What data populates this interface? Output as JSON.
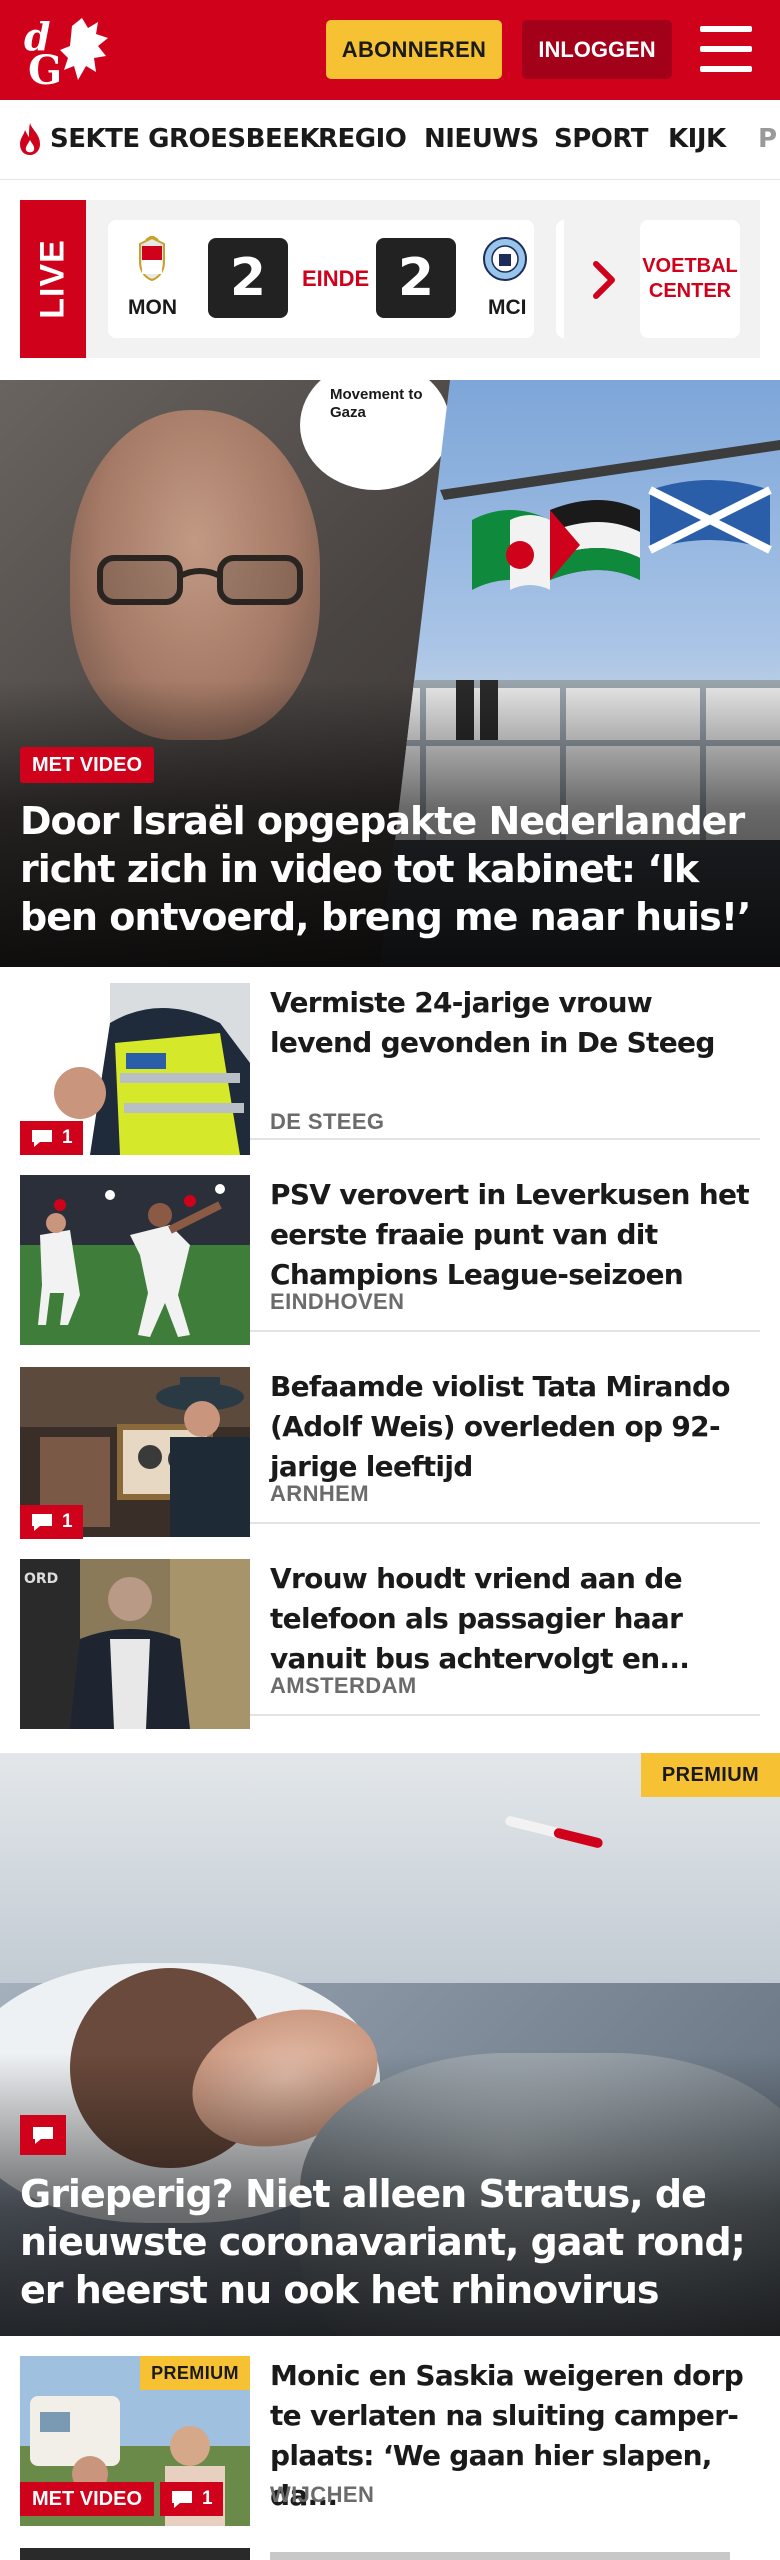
{
  "header": {
    "logo_text": "dG",
    "subscribe_label": "ABONNEREN",
    "login_label": "INLOGGEN",
    "colors": {
      "brand_red": "#d0021b",
      "subscribe_yellow": "#f6c233",
      "login_dark_red": "#a3001a"
    }
  },
  "nav": {
    "items": [
      {
        "label": "SEKTE GROESBEEK",
        "icon": "flame-icon"
      },
      {
        "label": "REGIO"
      },
      {
        "label": "NIEUWS"
      },
      {
        "label": "SPORT"
      },
      {
        "label": "KIJK"
      },
      {
        "label": "P"
      }
    ]
  },
  "live_score": {
    "live_label": "LIVE",
    "home_team": "MON",
    "home_score": "2",
    "status": "EINDE",
    "away_score": "2",
    "away_team": "MCI",
    "voetbal_center_label": "VOETBAL CENTER"
  },
  "hero": {
    "badge_text": "Movement to Gaza",
    "video_label": "MET VIDEO",
    "title": "Door Israël opgepakte Nederlander richt zich in video tot kabinet: ‘Ik ben ontvoerd, breng me naar huis!’"
  },
  "articles": [
    {
      "title": "Vermiste 24-jarige vrouw levend gevonden in De Steeg",
      "location": "DE STEEG",
      "comments": "1"
    },
    {
      "title": "PSV verovert in Leverkusen het eerste fraaie punt van dit Champions League-seizoen",
      "location": "EINDHOVEN"
    },
    {
      "title": "Befaamde violist Tata Mirando (Adolf Weis) overleden op 92-jarige leeftijd",
      "location": "ARNHEM",
      "comments": "1"
    },
    {
      "title": "Vrouw houdt vriend aan de telefoon als passagier haar vanuit bus achtervolgt en...",
      "location": "AMSTERDAM"
    }
  ],
  "feature": {
    "premium_label": "PREMIUM",
    "title": "Grieperig? Niet alleen Stratus, de nieuwste coronavariant, gaat rond; er heerst nu ook het rhinovirus"
  },
  "bottom_article": {
    "premium_label": "PREMIUM",
    "video_label": "MET VIDEO",
    "comments": "1",
    "title": "Monic en Saskia weigeren dorp te verlaten na sluiting camper-plaats: ‘We gaan hier slapen, da...",
    "location": "WIJCHEN"
  }
}
